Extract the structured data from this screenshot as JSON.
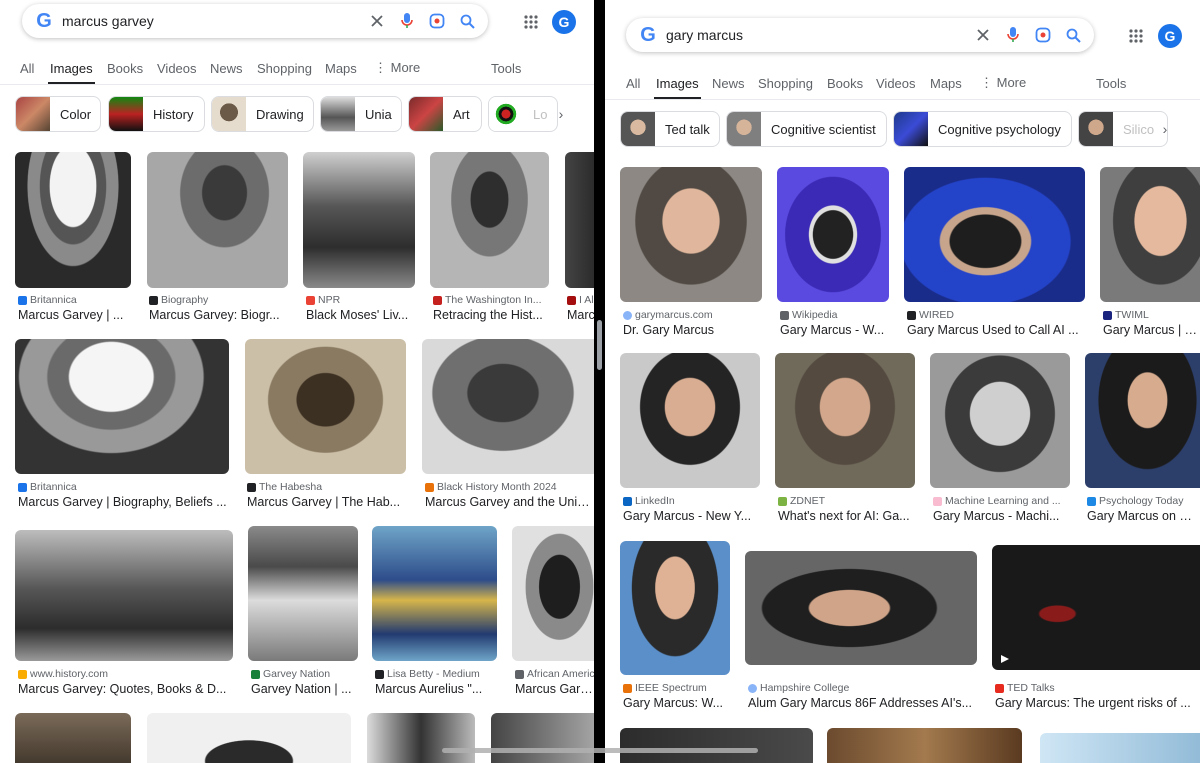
{
  "left": {
    "query": "marcus garvey",
    "avatar_letter": "G",
    "tabs": [
      "All",
      "Images",
      "Books",
      "Videos",
      "News",
      "Shopping",
      "Maps",
      "More",
      "Tools"
    ],
    "active_tab": "Images",
    "chips": [
      "Color",
      "History",
      "Drawing",
      "Unia",
      "Art",
      "Lo"
    ],
    "results": [
      {
        "source": "Britannica",
        "title": "Marcus Garvey | ..."
      },
      {
        "source": "Biography",
        "title": "Marcus Garvey: Biogr..."
      },
      {
        "source": "NPR",
        "title": "Black Moses' Liv..."
      },
      {
        "source": "The Washington In...",
        "title": "Retracing the Hist..."
      },
      {
        "source": "I Al",
        "title": "Marc"
      },
      {
        "source": "Britannica",
        "title": "Marcus Garvey | Biography, Beliefs ..."
      },
      {
        "source": "The Habesha",
        "title": "Marcus Garvey | The Hab..."
      },
      {
        "source": "Black History Month 2024",
        "title": "Marcus Garvey and the Univers"
      },
      {
        "source": "www.history.com",
        "title": "Marcus Garvey: Quotes, Books & D..."
      },
      {
        "source": "Garvey Nation",
        "title": "Garvey Nation | ..."
      },
      {
        "source": "Lisa Betty - Medium",
        "title": "Marcus Aurelius \"..."
      },
      {
        "source": "African Americ",
        "title": "Marcus Garvey"
      }
    ]
  },
  "right": {
    "query": "gary marcus",
    "avatar_letter": "G",
    "tabs": [
      "All",
      "Images",
      "News",
      "Shopping",
      "Books",
      "Videos",
      "Maps",
      "More",
      "Tools"
    ],
    "active_tab": "Images",
    "chips": [
      "Ted talk",
      "Cognitive scientist",
      "Cognitive psychology",
      "Silico"
    ],
    "results": [
      {
        "source": "garymarcus.com",
        "title": "Dr. Gary Marcus"
      },
      {
        "source": "Wikipedia",
        "title": "Gary Marcus - W..."
      },
      {
        "source": "WIRED",
        "title": "Gary Marcus Used to Call AI ..."
      },
      {
        "source": "TWIML",
        "title": "Gary Marcus | TW"
      },
      {
        "source": "LinkedIn",
        "title": "Gary Marcus - New Y..."
      },
      {
        "source": "ZDNET",
        "title": "What's next for AI: Ga..."
      },
      {
        "source": "Machine Learning and ...",
        "title": "Gary Marcus - Machi..."
      },
      {
        "source": "Psychology Today",
        "title": "Gary Marcus on Why"
      },
      {
        "source": "IEEE Spectrum",
        "title": "Gary Marcus: W..."
      },
      {
        "source": "Hampshire College",
        "title": "Alum Gary Marcus 86F Addresses AI's..."
      },
      {
        "source": "TED Talks",
        "title": "Gary Marcus: The urgent risks of ..."
      }
    ]
  }
}
